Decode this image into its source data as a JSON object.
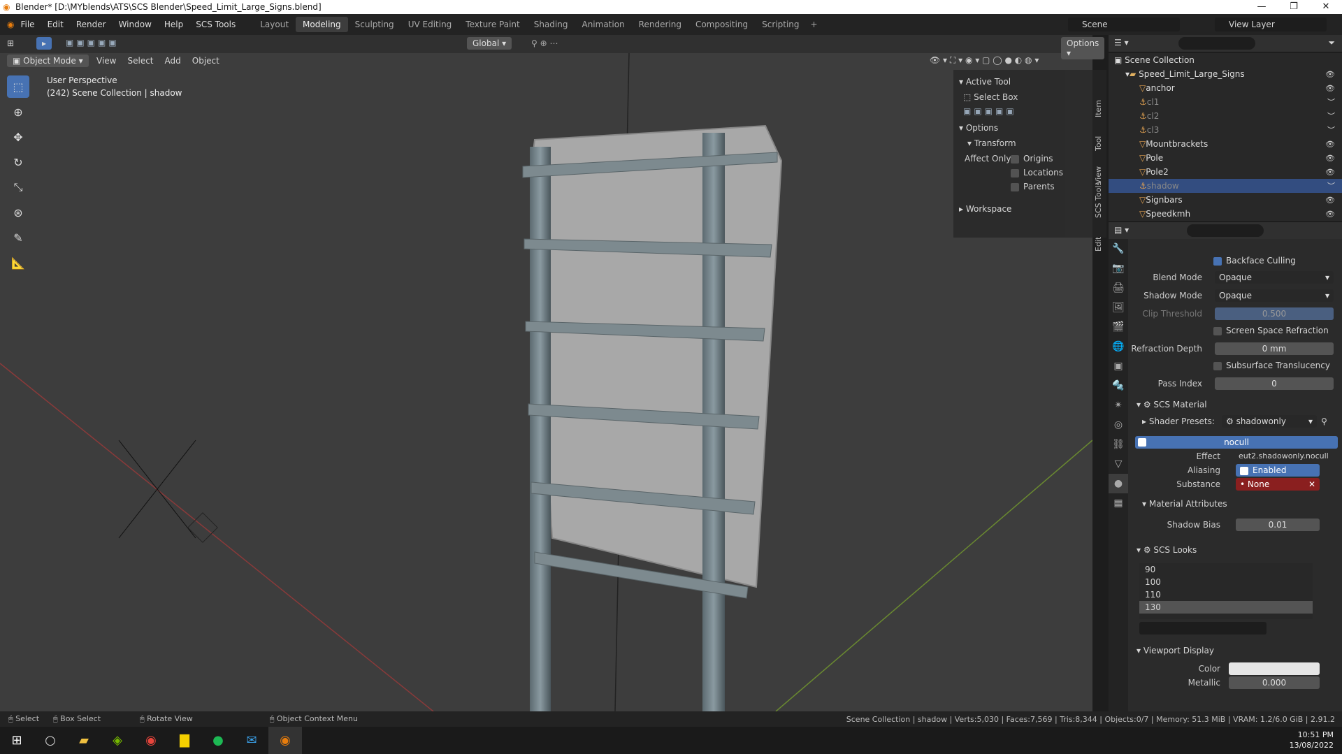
{
  "window": {
    "title": "Blender* [D:\\MYblends\\ATS\\SCS Blender\\Speed_Limit_Large_Signs.blend]"
  },
  "menu": [
    "File",
    "Edit",
    "Render",
    "Window",
    "Help",
    "SCS Tools"
  ],
  "workspaces": [
    "Layout",
    "Modeling",
    "Sculpting",
    "UV Editing",
    "Texture Paint",
    "Shading",
    "Animation",
    "Rendering",
    "Compositing",
    "Scripting"
  ],
  "workspace_active": "Modeling",
  "scene": {
    "label": "Scene",
    "view_layer": "View Layer"
  },
  "viewport": {
    "mode": "Object Mode",
    "menus": [
      "View",
      "Select",
      "Add",
      "Object"
    ],
    "transform": "Global",
    "options": "Options",
    "overlay_line1": "User Perspective",
    "overlay_line2": "(242) Scene Collection | shadow"
  },
  "npanel": {
    "active_tool": "Active Tool",
    "select_box": "Select Box",
    "options": "Options",
    "transform": "Transform",
    "affect_only": "Affect Only",
    "origins": "Origins",
    "locations": "Locations",
    "parents": "Parents",
    "workspace": "Workspace",
    "tabs": [
      "Item",
      "Tool",
      "View",
      "SCS Tools",
      "Edit"
    ]
  },
  "outliner": {
    "root": "Scene Collection",
    "collection": "Speed_Limit_Large_Signs",
    "items": [
      {
        "name": "anchor",
        "dim": false
      },
      {
        "name": "cl1",
        "dim": true
      },
      {
        "name": "cl2",
        "dim": true
      },
      {
        "name": "cl3",
        "dim": true
      },
      {
        "name": "Mountbrackets",
        "dim": false
      },
      {
        "name": "Pole",
        "dim": false
      },
      {
        "name": "Pole2",
        "dim": false
      },
      {
        "name": "shadow",
        "dim": true,
        "selected": true
      },
      {
        "name": "Signbars",
        "dim": false
      },
      {
        "name": "Speedkmh",
        "dim": false
      }
    ]
  },
  "properties": {
    "backface_culling": "Backface Culling",
    "blend_mode_label": "Blend Mode",
    "blend_mode": "Opaque",
    "shadow_mode_label": "Shadow Mode",
    "shadow_mode": "Opaque",
    "clip_label": "Clip Threshold",
    "clip": "0.500",
    "ssr": "Screen Space Refraction",
    "refraction_label": "Refraction Depth",
    "refraction": "0 mm",
    "sss": "Subsurface Translucency",
    "pass_label": "Pass Index",
    "pass": "0",
    "scs_material": "SCS Material",
    "shader_presets_label": "Shader Presets:",
    "shader_presets": "shadowonly",
    "nocull": "nocull",
    "effect_label": "Effect",
    "effect": "eut2.shadowonly.nocull",
    "aliasing_label": "Aliasing",
    "aliasing": "Enabled",
    "substance_label": "Substance",
    "substance": "None",
    "mat_attr": "Material Attributes",
    "shadow_bias_label": "Shadow Bias",
    "shadow_bias": "0.01",
    "scs_looks": "SCS Looks",
    "looks": [
      "90",
      "100",
      "110",
      "130"
    ],
    "looks_selected": "130",
    "viewport_display": "Viewport Display",
    "color_label": "Color",
    "metallic_label": "Metallic",
    "metallic": "0.000"
  },
  "status": {
    "select": "Select",
    "box_select": "Box Select",
    "rotate": "Rotate View",
    "context": "Object Context Menu",
    "info": "Scene Collection | shadow | Verts:5,030 | Faces:7,569 | Tris:8,344 | Objects:0/7 | Memory: 51.3 MiB | VRAM: 1.2/6.0 GiB | 2.91.2"
  },
  "taskbar": {
    "time": "10:51 PM",
    "date": "13/08/2022"
  }
}
